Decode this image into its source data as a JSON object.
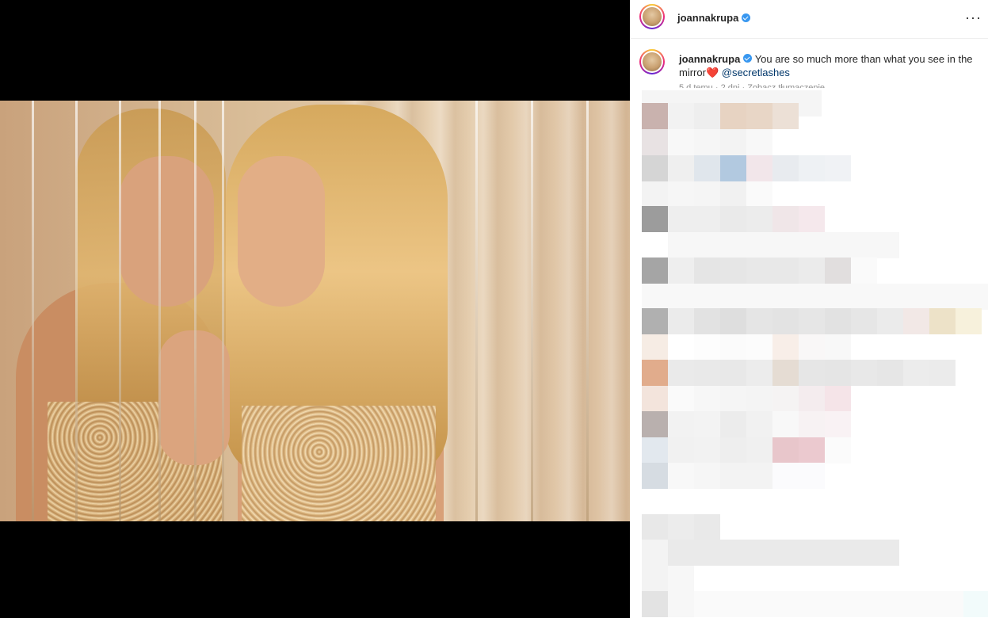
{
  "post": {
    "username": "joannakrupa",
    "verified": true,
    "caption_text": "You are so much more than what you see in the mirror",
    "caption_emoji": "❤️",
    "caption_mention": "@secretlashes",
    "meta_text": "5 d temu · 2 dni · Zobacz tłumaczenie"
  },
  "icons": {
    "more": "more-options-icon",
    "verified": "verified-badge-icon",
    "user_tag": "user-tag-icon"
  },
  "colors": {
    "verified": "#3897f0",
    "mention": "#00376b",
    "heart": "#ed4956"
  }
}
